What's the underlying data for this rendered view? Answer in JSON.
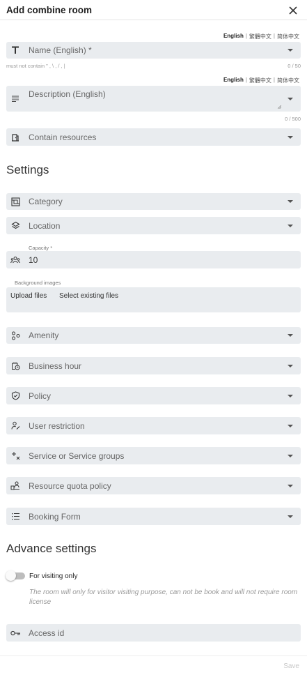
{
  "header": {
    "title": "Add combine room"
  },
  "lang_tabs": {
    "english": "English",
    "trad": "繁體中文",
    "simp": "简体中文"
  },
  "name_field": {
    "label": "Name (English) *",
    "hint": "must not contain \" , \\ , / , |",
    "counter": "0 / 50"
  },
  "description_field": {
    "label": "Description (English)",
    "counter": "0 / 500"
  },
  "contain_resources": {
    "label": "Contain resources"
  },
  "settings": {
    "title": "Settings",
    "category": "Category",
    "location": "Location",
    "capacity_label": "Capacity *",
    "capacity_value": "10",
    "background_label": "Background images",
    "upload": "Upload files",
    "select_existing": "Select existing files",
    "amenity": "Amenity",
    "business_hour": "Business hour",
    "policy": "Policy",
    "user_restriction": "User restriction",
    "service": "Service or Service groups",
    "quota": "Resource quota policy",
    "booking_form": "Booking Form"
  },
  "advance": {
    "title": "Advance settings",
    "visiting_label": "For visiting only",
    "visiting_desc": "The room will only for visitor visiting purpose, can not be book and will not require room license",
    "access_id": "Access id"
  },
  "footer": {
    "save": "Save"
  }
}
